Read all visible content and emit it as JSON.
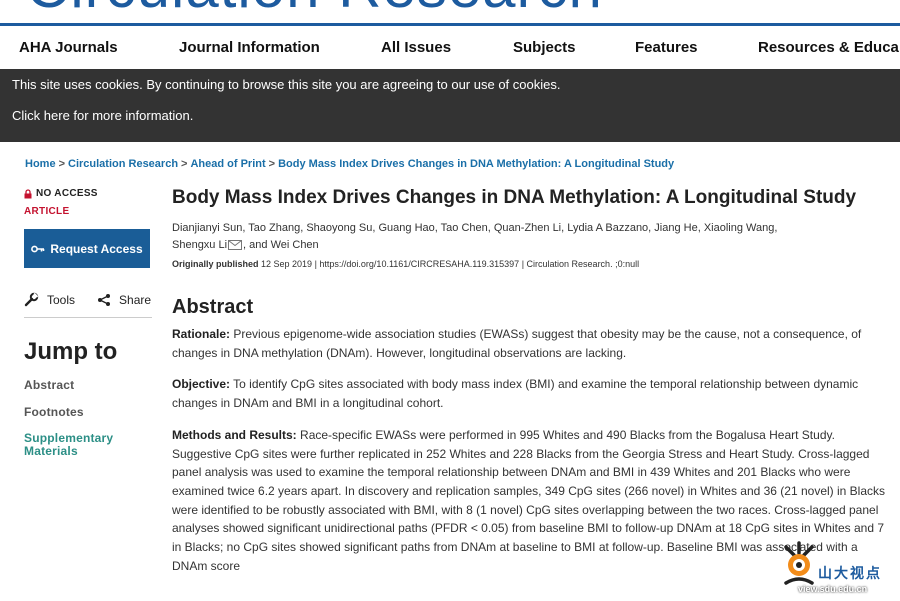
{
  "masthead": {
    "title": "Circulation Research"
  },
  "nav": {
    "items": [
      {
        "label": "AHA Journals"
      },
      {
        "label": "Journal Information"
      },
      {
        "label": "All Issues"
      },
      {
        "label": "Subjects"
      },
      {
        "label": "Features"
      },
      {
        "label": "Resources & Educa"
      }
    ]
  },
  "cookie": {
    "message": "This site uses cookies. By continuing to browse this site you are agreeing to our use of cookies.",
    "more_link": "Click here for more information."
  },
  "breadcrumb": {
    "items": [
      "Home",
      "Circulation Research",
      "Ahead of Print",
      "Body Mass Index Drives Changes in DNA Methylation: A Longitudinal Study"
    ],
    "separator": ">"
  },
  "sidebar": {
    "access": "NO ACCESS",
    "article_type": "ARTICLE",
    "request_access": "Request Access",
    "tools": "Tools",
    "share": "Share",
    "jump_to": "Jump to",
    "links": [
      "Abstract",
      "Footnotes",
      "Supplementary Materials"
    ]
  },
  "article": {
    "title": "Body Mass Index Drives Changes in DNA Methylation: A Longitudinal Study",
    "authors_line1": "Dianjianyi Sun, Tao Zhang, Shaoyong Su, Guang Hao, Tao Chen, Quan-Zhen Li, Lydia A Bazzano, Jiang He, Xiaoling Wang,",
    "authors_line2a": "Shengxu Li",
    "authors_line2b": ", and Wei Chen",
    "published_label": "Originally published",
    "published_rest": " 12 Sep 2019 | https://doi.org/10.1161/CIRCRESAHA.119.315397 | Circulation Research. ;0:null"
  },
  "abstract": {
    "heading": "Abstract",
    "rationale_label": "Rationale:",
    "rationale_text": " Previous epigenome-wide association studies (EWASs) suggest that obesity may be the cause, not a consequence, of changes in DNA methylation (DNAm). However, longitudinal observations are lacking.",
    "objective_label": "Objective:",
    "objective_text": " To identify CpG sites associated with body mass index (BMI) and examine the temporal relationship between dynamic changes in DNAm and BMI in a longitudinal cohort.",
    "methods_label": "Methods and Results:",
    "methods_text": " Race-specific EWASs were performed in 995 Whites and 490 Blacks from the Bogalusa Heart Study. Suggestive CpG sites were further replicated in 252 Whites and 228 Blacks from the Georgia Stress and Heart Study. Cross-lagged panel analysis was used to examine the temporal relationship between DNAm and BMI in 439 Whites and 201 Blacks who were examined twice 6.2 years apart. In discovery and replication samples, 349 CpG sites (266 novel) in Whites and 36 (21 novel) in Blacks were identified to be robustly associated with BMI, with 8 (1 novel) CpG sites overlapping between the two races. Cross-lagged panel analyses showed significant unidirectional paths (PFDR < 0.05) from baseline BMI to follow-up DNAm at 18 CpG sites in Whites and 7 in Blacks; no CpG sites showed significant paths from DNAm at baseline to BMI at follow-up. Baseline BMI was associated with a DNAm score"
  },
  "watermark": {
    "text": "山大视点",
    "url": "view.sdu.edu.cn"
  },
  "colors": {
    "brand": "#1d5b9f",
    "cookie_bg": "#333333",
    "button": "#1a5d97",
    "article_red": "#c4122f",
    "supplementary": "#2c8f86"
  }
}
